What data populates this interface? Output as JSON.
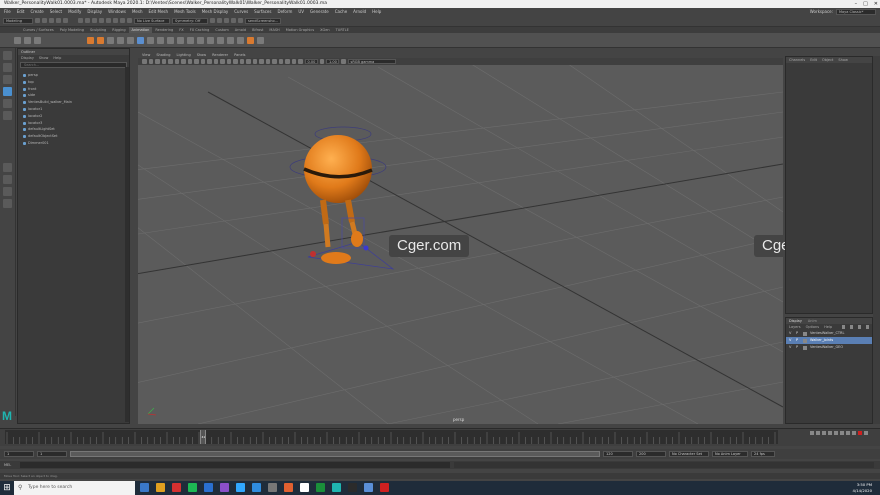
{
  "window": {
    "title": "Walker_PersonalityWalk01.0003.ma* - Autodesk Maya 2020.1: D:\\Ventes\\Scenes\\Walker_PersonalityWalk01\\Walker_PersonalityWalk01.0003.ma",
    "controls": [
      "–",
      "□",
      "✕"
    ]
  },
  "menubar": {
    "items": [
      "File",
      "Edit",
      "Create",
      "Select",
      "Modify",
      "Display",
      "Windows",
      "Mesh",
      "Edit Mesh",
      "Mesh Tools",
      "Mesh Display",
      "Curves",
      "Surfaces",
      "Deform",
      "UV",
      "Generate",
      "Cache",
      "Arnold",
      "Help"
    ],
    "workspace_label": "Workspace:",
    "workspace_value": "Maya Classic*"
  },
  "statusline": {
    "mode": "Modeling",
    "no_live": "No Live Surface",
    "symmetry": "Symmetry: Off",
    "input_field": "sendScreensho..."
  },
  "shelf": {
    "tabs": [
      "Curves / Surfaces",
      "Poly Modeling",
      "Sculpting",
      "Rigging",
      "Animation",
      "Rendering",
      "FX",
      "FX Caching",
      "Custom",
      "Arnold",
      "Bifrost",
      "MASH",
      "Motion Graphics",
      "XGen",
      "TURTLE"
    ],
    "active_tab": "Animation"
  },
  "outliner": {
    "title": "Outliner",
    "menu": [
      "Display",
      "Show",
      "Help"
    ],
    "search_placeholder": "Search...",
    "items": [
      "persp",
      "top",
      "front",
      "side",
      "VentesBuild_walker_Main",
      "locator1",
      "locator2",
      "locator3",
      "defaultLightSet",
      "defaultObjectSet",
      "Dimmer001"
    ]
  },
  "viewport": {
    "menu": [
      "View",
      "Shading",
      "Lighting",
      "Show",
      "Renderer",
      "Panels"
    ],
    "field_a": "0.00",
    "field_b": "1.00",
    "color_space": "sRGB gamma",
    "camera_label": "persp",
    "watermarks": [
      "Cger.com",
      "Cger.com"
    ]
  },
  "channelbox": {
    "menu": [
      "Channels",
      "Edit",
      "Object",
      "Show"
    ]
  },
  "layers": {
    "tabs": [
      "Display",
      "Anim"
    ],
    "menu": [
      "Layers",
      "Options",
      "Help"
    ],
    "rows": [
      {
        "v": "V",
        "p": "P",
        "name": "VentesWalker_CTRL"
      },
      {
        "v": "V",
        "p": "P",
        "name": "Walker_Joints"
      },
      {
        "v": "V",
        "p": "P",
        "name": "VentesWalker_GEO"
      }
    ],
    "selected_index": 1
  },
  "timeline": {
    "current_frame": "41",
    "range_start": "1",
    "range_start_2": "1",
    "range_end": "120",
    "range_end_2": "200",
    "character_set": "No Character Set",
    "anim_layer": "No Anim Layer",
    "fps": "24 fps"
  },
  "commandline": {
    "lang": "MEL",
    "help": "Move Tool: Select an object to drag."
  },
  "taskbar": {
    "search_placeholder": "Type here to search",
    "time": "3:50 PM",
    "date": "4/14/2020",
    "icon_colors": [
      "#3a78c8",
      "#e0a020",
      "#d43030",
      "#1db954",
      "#2a6fd0",
      "#8a4fc8",
      "#31a8ff",
      "#2f8cde",
      "#777777",
      "#e06030",
      "#ffffff",
      "#1a8f3a",
      "#1fb5b0",
      "#2b2b2b",
      "#5a8fd8",
      "#d02020"
    ]
  },
  "colors": {
    "accent": "#4a90d0",
    "robot_orange": "#e07a1a",
    "viewport_bg": "#5b5b5b"
  }
}
